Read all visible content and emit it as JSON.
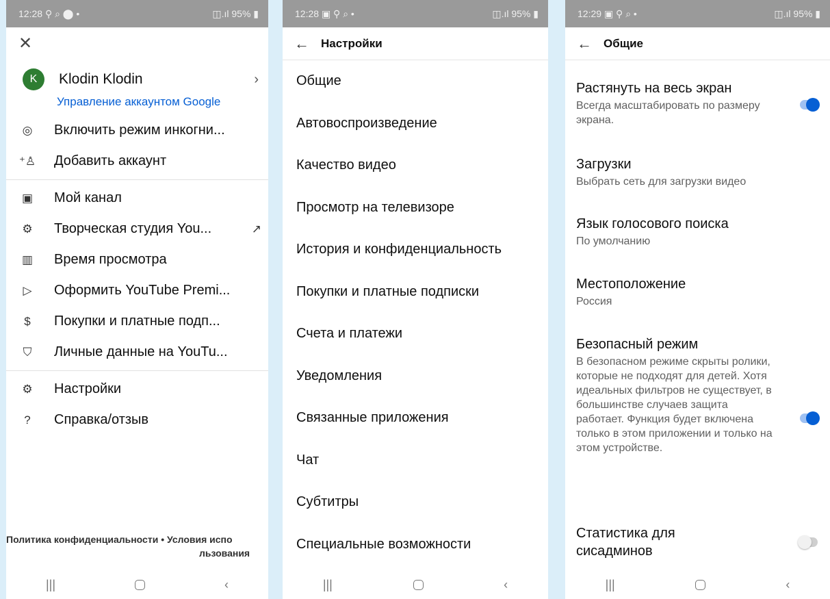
{
  "panel1": {
    "status": {
      "time": "12:28",
      "icons": "⚲ ⌕ ⬤ •",
      "battery": "95%"
    },
    "account": {
      "initial": "K",
      "name": "Klodin Klodin",
      "manage_link": "Управление аккаунтом Google"
    },
    "menu_group1": [
      {
        "icon": "incognito-icon",
        "label": "Включить режим инкогни..."
      },
      {
        "icon": "add-account-icon",
        "label": "Добавить аккаунт"
      }
    ],
    "menu_group2": [
      {
        "icon": "channel-icon",
        "label": "Мой канал"
      },
      {
        "icon": "studio-icon",
        "label": "Творческая студия You..."
      },
      {
        "icon": "stats-icon",
        "label": "Время просмотра"
      },
      {
        "icon": "premium-icon",
        "label": "Оформить YouTube Premi..."
      },
      {
        "icon": "dollar-icon",
        "label": "Покупки и платные подп..."
      },
      {
        "icon": "privacy-icon",
        "label": "Личные данные на YouTu..."
      }
    ],
    "menu_group3": [
      {
        "icon": "gear-icon",
        "label": "Настройки"
      },
      {
        "icon": "help-icon",
        "label": "Справка/отзыв"
      }
    ],
    "footer": {
      "privacy": "Политика конфиденциальности",
      "separator": "•",
      "terms_part1": "Условия испо",
      "terms_part2": "льзования"
    }
  },
  "panel2": {
    "status": {
      "time": "12:28",
      "icons": "▣ ⚲ ⌕ •",
      "battery": "95%"
    },
    "title": "Настройки",
    "items": [
      "Общие",
      "Автовоспроизведение",
      "Качество видео",
      "Просмотр на телевизоре",
      "История и конфиденциальность",
      "Покупки и платные подписки",
      "Счета и платежи",
      "Уведомления",
      "Связанные приложения",
      "Чат",
      "Субтитры",
      "Специальные возможности"
    ]
  },
  "panel3": {
    "status": {
      "time": "12:29",
      "icons": "▣ ⚲ ⌕ •",
      "battery": "95%"
    },
    "title": "Общие",
    "items": [
      {
        "title": "Растянуть на весь экран",
        "subtitle": "Всегда масштабировать по размеру экрана.",
        "toggle": true
      },
      {
        "title": "Загрузки",
        "subtitle": "Выбрать сеть для загрузки видео"
      },
      {
        "title": "Язык голосового поиска",
        "subtitle": "По умолчанию"
      },
      {
        "title": "Местоположение",
        "subtitle": "Россия"
      },
      {
        "title": "Безопасный режим",
        "subtitle": "В безопасном режиме скрыты ролики, которые не подходят для детей. Хотя идеальных фильтров не существует, в большинстве случаев защита работает. Функция будет включена только в этом приложении и только на этом устройстве.",
        "toggle": true
      },
      {
        "title": "Статистика для сисадминов",
        "toggle": false
      }
    ]
  }
}
